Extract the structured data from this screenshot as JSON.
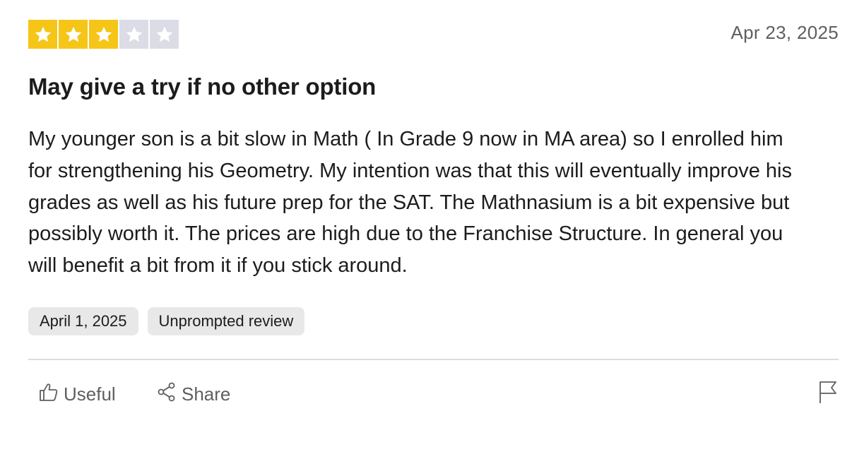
{
  "review": {
    "rating": 3,
    "rating_max": 5,
    "star_color": "#f5c518",
    "star_empty_color": "#dcdce6",
    "date": "Apr 23, 2025",
    "title": "May give a try if no other option",
    "body": "My younger son is a bit slow in Math ( In Grade 9 now in  MA  area) so I enrolled him for strengthening his Geometry. My intention was that this will eventually improve his grades as well as his future prep for the SAT. The Mathnasium is a bit expensive but possibly worth it. The prices are high due to the Franchise Structure. In general you will benefit a bit from it if you stick around.",
    "experience_date": "April 1, 2025",
    "review_type": "Unprompted review"
  },
  "actions": {
    "useful_label": "Useful",
    "useful_icon": "thumbs-up-icon",
    "share_label": "Share",
    "share_icon": "share-icon",
    "flag_icon": "flag-icon"
  }
}
